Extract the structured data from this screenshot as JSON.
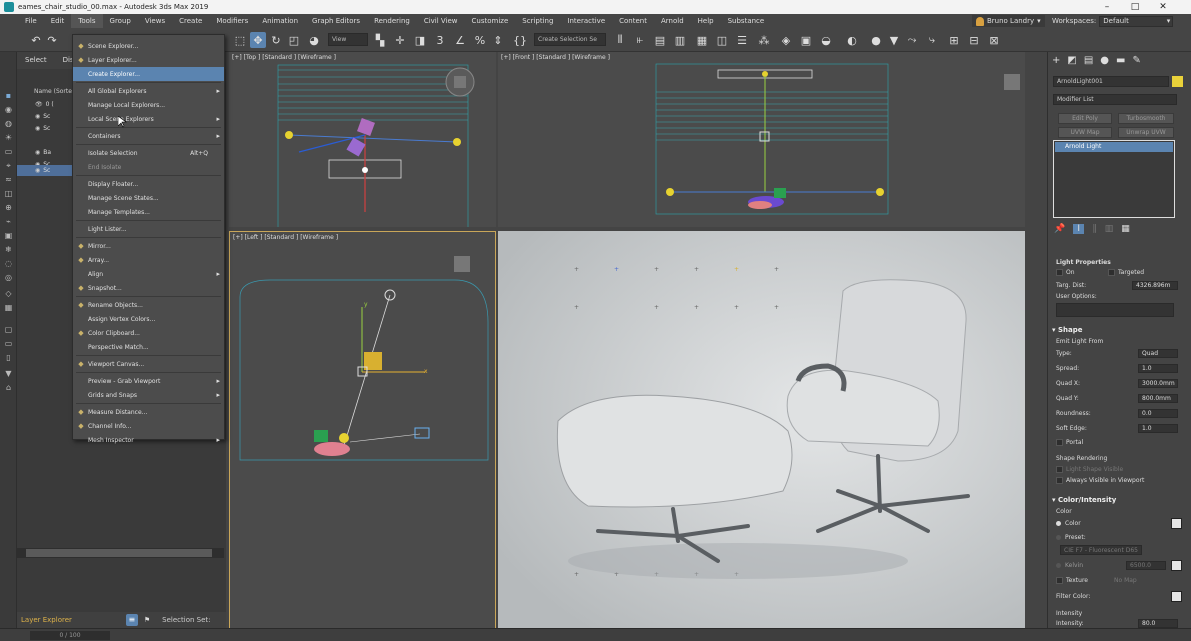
{
  "window": {
    "title": "eames_chair_studio_00.max - Autodesk 3ds Max 2019",
    "controls": [
      "–",
      "□",
      "✕"
    ]
  },
  "menubar": {
    "items": [
      "File",
      "Edit",
      "Tools",
      "Group",
      "Views",
      "Create",
      "Modifiers",
      "Animation",
      "Graph Editors",
      "Rendering",
      "Civil View",
      "Customize",
      "Scripting",
      "Interactive",
      "Content",
      "Arnold",
      "Help",
      "Substance"
    ],
    "active": "Tools",
    "user": "Bruno Landry",
    "workspaces_label": "Workspaces:",
    "workspace_value": "Default"
  },
  "toolbar": {
    "view_dropdown": "View",
    "selection_set": "Create Selection Se"
  },
  "left_panel": {
    "tabs": [
      "Select",
      "Disp"
    ],
    "header": "Name (Sorte",
    "rows": [
      "0 (",
      "Sc",
      "Sc",
      "Ba",
      "Sc",
      "Sc"
    ],
    "footer_label": "Layer Explorer",
    "footer_combo": "Selection Set:",
    "frame": "0 / 100"
  },
  "tools_menu": {
    "items": [
      {
        "label": "Scene Explorer...",
        "icon": "explorer-icon"
      },
      {
        "label": "Layer Explorer...",
        "icon": "layer-icon"
      },
      {
        "label": "Create Explorer...",
        "highlight": true
      },
      {
        "label": "All Global Explorers",
        "submenu": true
      },
      {
        "label": "Manage Local Explorers..."
      },
      {
        "label": "Local Scene Explorers",
        "submenu": true
      },
      {
        "label": "Containers",
        "submenu": true
      },
      {
        "label": "Isolate Selection",
        "shortcut": "Alt+Q"
      },
      {
        "label": "End Isolate",
        "disabled": true
      },
      {
        "label": "Display Floater..."
      },
      {
        "label": "Manage Scene States..."
      },
      {
        "label": "Manage Templates..."
      },
      {
        "label": "Light Lister..."
      },
      {
        "label": "Mirror...",
        "icon": "mirror-icon"
      },
      {
        "label": "Array...",
        "icon": "array-icon"
      },
      {
        "label": "Align",
        "submenu": true
      },
      {
        "label": "Snapshot...",
        "icon": "snapshot-icon"
      },
      {
        "label": "Rename Objects...",
        "icon": "rename-icon"
      },
      {
        "label": "Assign Vertex Colors..."
      },
      {
        "label": "Color Clipboard...",
        "icon": "clipboard-icon"
      },
      {
        "label": "Perspective Match..."
      },
      {
        "label": "Viewport Canvas...",
        "icon": "canvas-icon"
      },
      {
        "label": "Preview - Grab Viewport",
        "submenu": true
      },
      {
        "label": "Grids and Snaps",
        "submenu": true
      },
      {
        "label": "Measure Distance...",
        "icon": "measure-icon"
      },
      {
        "label": "Channel Info...",
        "icon": "channel-icon"
      },
      {
        "label": "Mesh Inspector",
        "submenu": true
      }
    ]
  },
  "viewports": {
    "top": "[+] [Top ] [Standard ] [Wireframe ]",
    "front": "[+] [Front ] [Standard ] [Wireframe ]",
    "left": "[+] [Left ] [Standard ] [Wireframe ]",
    "left_axis_x": "x",
    "left_axis_y": "y"
  },
  "right_panel": {
    "object_name": "ArnoldLight001",
    "modifier_list": "Modifier List",
    "buttons": [
      "Edit Poly",
      "Turbosmooth",
      "UVW Map",
      "Unwrap UVW"
    ],
    "stack_item": "Arnold Light",
    "light_properties": {
      "title": "Light Properties",
      "on": "On",
      "targeted": "Targeted",
      "targ_dist_label": "Targ. Dist:",
      "targ_dist": "4326.896m",
      "user_options": "User Options:"
    },
    "shape": {
      "title": "Shape",
      "emit_from": "Emit Light From",
      "type_label": "Type:",
      "type": "Quad",
      "spread_label": "Spread:",
      "spread": "1.0",
      "quad_x_label": "Quad X:",
      "quad_x": "3000.0mm",
      "quad_y_label": "Quad Y:",
      "quad_y": "800.0mm",
      "roundness_label": "Roundness:",
      "roundness": "0.0",
      "soft_edge_label": "Soft Edge:",
      "soft_edge": "1.0",
      "portal": "Portal",
      "rendering": "Shape Rendering",
      "light_shape_visible": "Light Shape Visible",
      "always_visible": "Always Visible in Viewport"
    },
    "color": {
      "title": "Color/Intensity",
      "color_label": "Color",
      "color_opt": "Color",
      "preset": "Preset:",
      "preset_value": "CIE F7 - Fluorescent D65",
      "kelvin": "Kelvin",
      "kelvin_value": "6500.0",
      "texture": "Texture",
      "texture_value": "No Map",
      "filter": "Filter Color:",
      "intensity_label": "Intensity",
      "intensity2": "Intensity:",
      "intensity_value": "80.0"
    }
  },
  "colors": {
    "accent": "#5b84b0",
    "viewport_active": "#c9a659"
  }
}
